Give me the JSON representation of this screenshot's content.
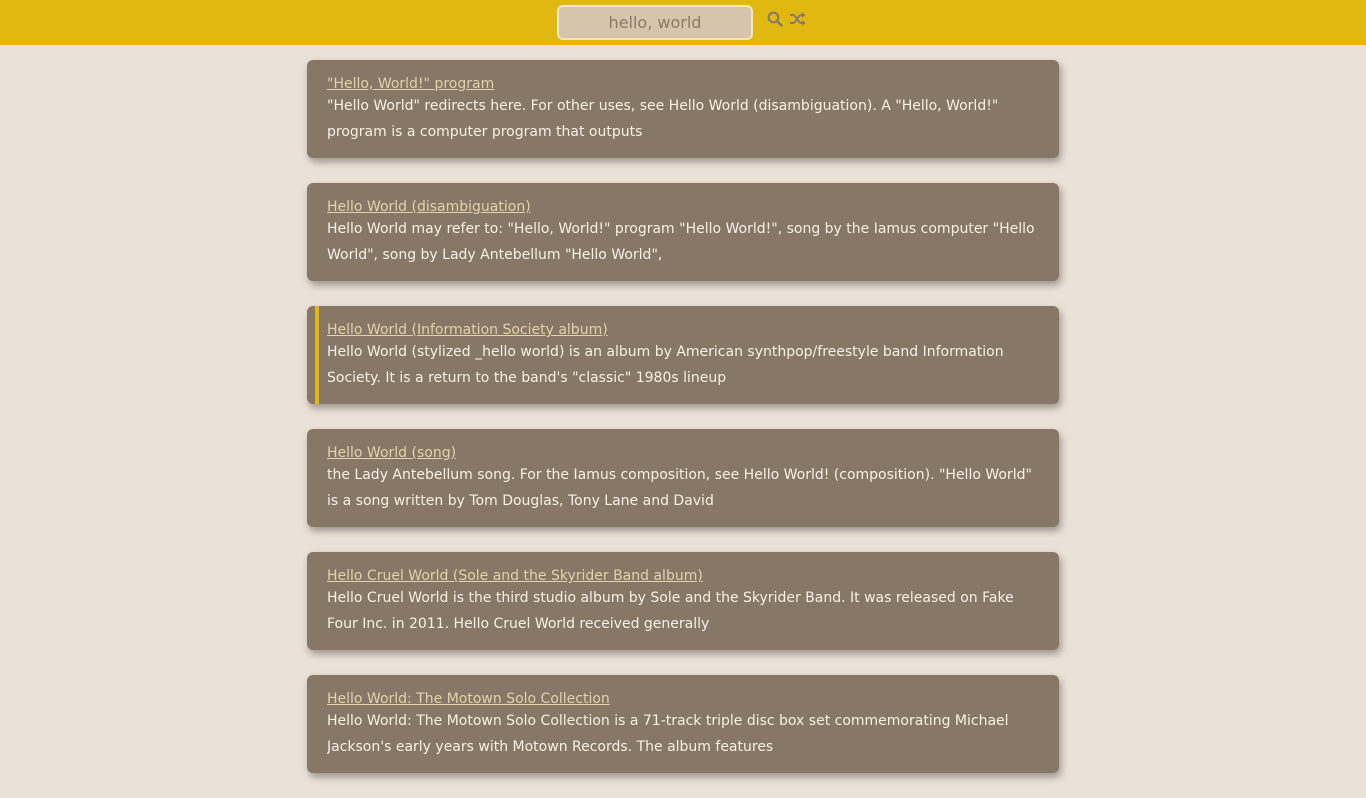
{
  "search": {
    "value": "hello, world",
    "search_icon": "search-icon",
    "shuffle_icon": "shuffle-icon"
  },
  "colors": {
    "topbar": "#e0b80f",
    "page_bg": "#ebe2d7",
    "card_bg": "#877767",
    "title_link": "#e3d2ab",
    "snippet_text": "#f7f0e6",
    "active_marker": "#e0b80f"
  },
  "results": [
    {
      "title": "\"Hello, World!\" program",
      "snippet": "\"Hello World\" redirects here. For other uses, see Hello World (disambiguation). A \"Hello, World!\" program is a computer program that outputs"
    },
    {
      "title": "Hello World (disambiguation)",
      "snippet": "Hello World may refer to: \"Hello, World!\" program \"Hello World!\", song by the Iamus computer \"Hello World\", song by Lady Antebellum \"Hello World\","
    },
    {
      "title": "Hello World (Information Society album)",
      "snippet": "Hello World (stylized _hello world) is an album by American synthpop/freestyle band Information Society. It is a return to the band's \"classic\" 1980s lineup"
    },
    {
      "title": "Hello World (song)",
      "snippet": "the Lady Antebellum song. For the Iamus composition, see Hello World! (composition). \"Hello World\" is a song written by Tom Douglas, Tony Lane and David"
    },
    {
      "title": "Hello Cruel World (Sole and the Skyrider Band album)",
      "snippet": "Hello Cruel World is the third studio album by Sole and the Skyrider Band. It was released on Fake Four Inc. in 2011. Hello Cruel World received generally"
    },
    {
      "title": "Hello World: The Motown Solo Collection",
      "snippet": "Hello World: The Motown Solo Collection is a 71-track triple disc box set commemorating Michael Jackson's early years with Motown Records. The album features"
    }
  ]
}
